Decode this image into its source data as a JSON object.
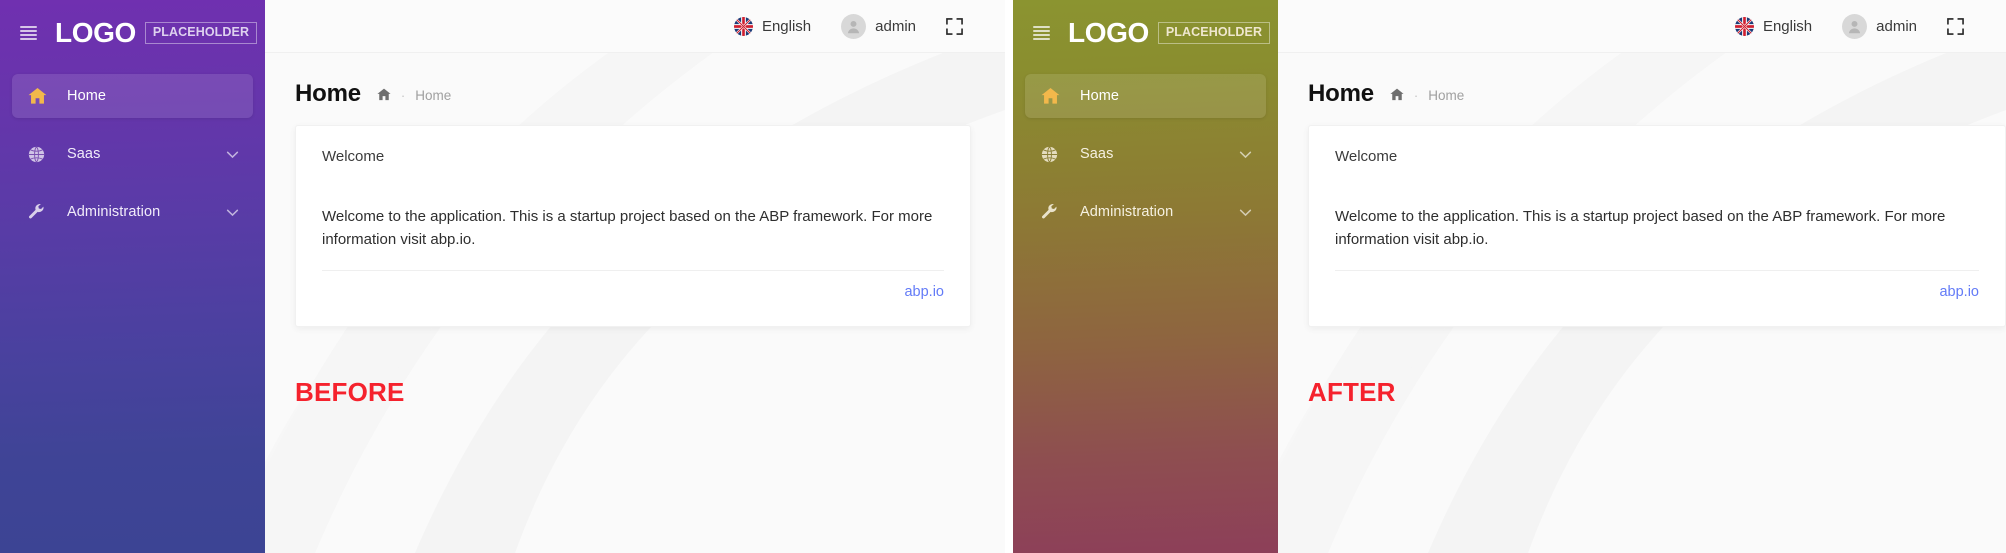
{
  "panels": [
    {
      "key": "before",
      "stamp": "BEFORE",
      "theme_name": "purple-gradient",
      "sidebar": {
        "gradient_from": "#7030b0",
        "gradient_to": "#3c4494",
        "logo": {
          "main": "LOGO",
          "sub": "PLACEHOLDER"
        },
        "menu_icon": "hamburger-icon",
        "items": [
          {
            "label": "Home",
            "icon": "home-icon",
            "active": true,
            "expandable": false
          },
          {
            "label": "Saas",
            "icon": "globe-icon",
            "active": false,
            "expandable": true
          },
          {
            "label": "Administration",
            "icon": "wrench-icon",
            "active": false,
            "expandable": true
          }
        ]
      },
      "topbar": {
        "language": "English",
        "language_icon": "uk-flag-icon",
        "user": "admin",
        "user_icon": "avatar-icon",
        "fullscreen_icon": "fullscreen-icon"
      },
      "page": {
        "title": "Home",
        "breadcrumb_home_icon": "home-icon",
        "breadcrumb_separator": "·",
        "breadcrumb_current": "Home"
      },
      "card": {
        "title": "Welcome",
        "body": "Welcome to the application. This is a startup project based on the ABP framework. For more information visit abp.io.",
        "link": "abp.io",
        "link_color": "#637bf7"
      }
    },
    {
      "key": "after",
      "stamp": "AFTER",
      "theme_name": "olive-maroon-gradient",
      "sidebar": {
        "gradient_from": "#8b9430",
        "gradient_to": "#8d3f59",
        "logo": {
          "main": "LOGO",
          "sub": "PLACEHOLDER"
        },
        "menu_icon": "hamburger-icon",
        "items": [
          {
            "label": "Home",
            "icon": "home-icon",
            "active": true,
            "expandable": false
          },
          {
            "label": "Saas",
            "icon": "globe-icon",
            "active": false,
            "expandable": true
          },
          {
            "label": "Administration",
            "icon": "wrench-icon",
            "active": false,
            "expandable": true
          }
        ]
      },
      "topbar": {
        "language": "English",
        "language_icon": "uk-flag-icon",
        "user": "admin",
        "user_icon": "avatar-icon",
        "fullscreen_icon": "fullscreen-icon"
      },
      "page": {
        "title": "Home",
        "breadcrumb_home_icon": "home-icon",
        "breadcrumb_separator": "·",
        "breadcrumb_current": "Home"
      },
      "card": {
        "title": "Welcome",
        "body": "Welcome to the application. This is a startup project based on the ABP framework. For more information visit abp.io.",
        "link": "abp.io",
        "link_color": "#637bf7"
      }
    }
  ],
  "stamp_color": "#f5222d",
  "content_background": "#fafafa",
  "home_icon_color": "#f2b84b"
}
